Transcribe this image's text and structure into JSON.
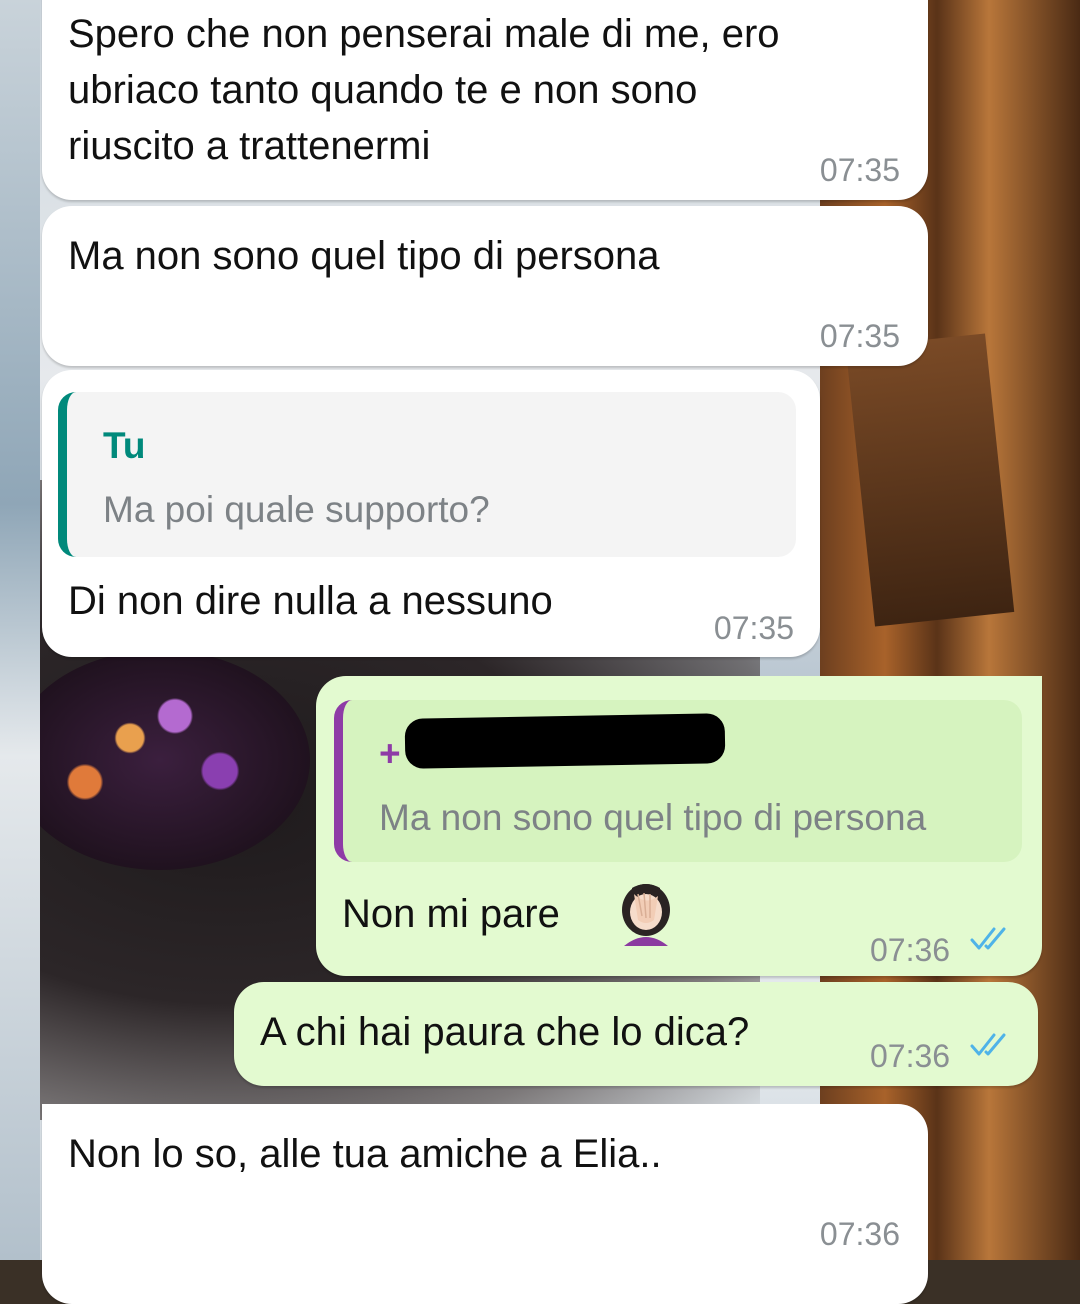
{
  "colors": {
    "incoming_bubble": "#ffffff",
    "outgoing_bubble": "#e3fad0",
    "timestamp": "#8a8f93",
    "read_ticks": "#4fb3e8",
    "reply_own_bar": "#00897b",
    "reply_contact_bar": "#8e3ba6"
  },
  "messages": [
    {
      "direction": "incoming",
      "text": "Spero che non penserai male di me, ero\nubriaco tanto quando te e non sono\nriuscito a trattenermi",
      "time": "07:35"
    },
    {
      "direction": "incoming",
      "text": "Ma non sono quel tipo di persona",
      "time": "07:35"
    },
    {
      "direction": "incoming",
      "reply": {
        "author": "Tu",
        "text": "Ma poi quale supporto?"
      },
      "text": "Di non dire nulla a nessuno",
      "time": "07:35"
    },
    {
      "direction": "outgoing",
      "reply": {
        "author": "+",
        "author_redacted": true,
        "text": "Ma non sono quel tipo di persona"
      },
      "text": "Non mi pare",
      "emoji": "woman-facepalming-icon",
      "time": "07:36",
      "status": "read"
    },
    {
      "direction": "outgoing",
      "text": "A chi hai paura che lo dica?",
      "time": "07:36",
      "status": "read"
    },
    {
      "direction": "incoming",
      "text": "Non lo so, alle tua amiche a Elia..",
      "time": "07:36"
    }
  ]
}
